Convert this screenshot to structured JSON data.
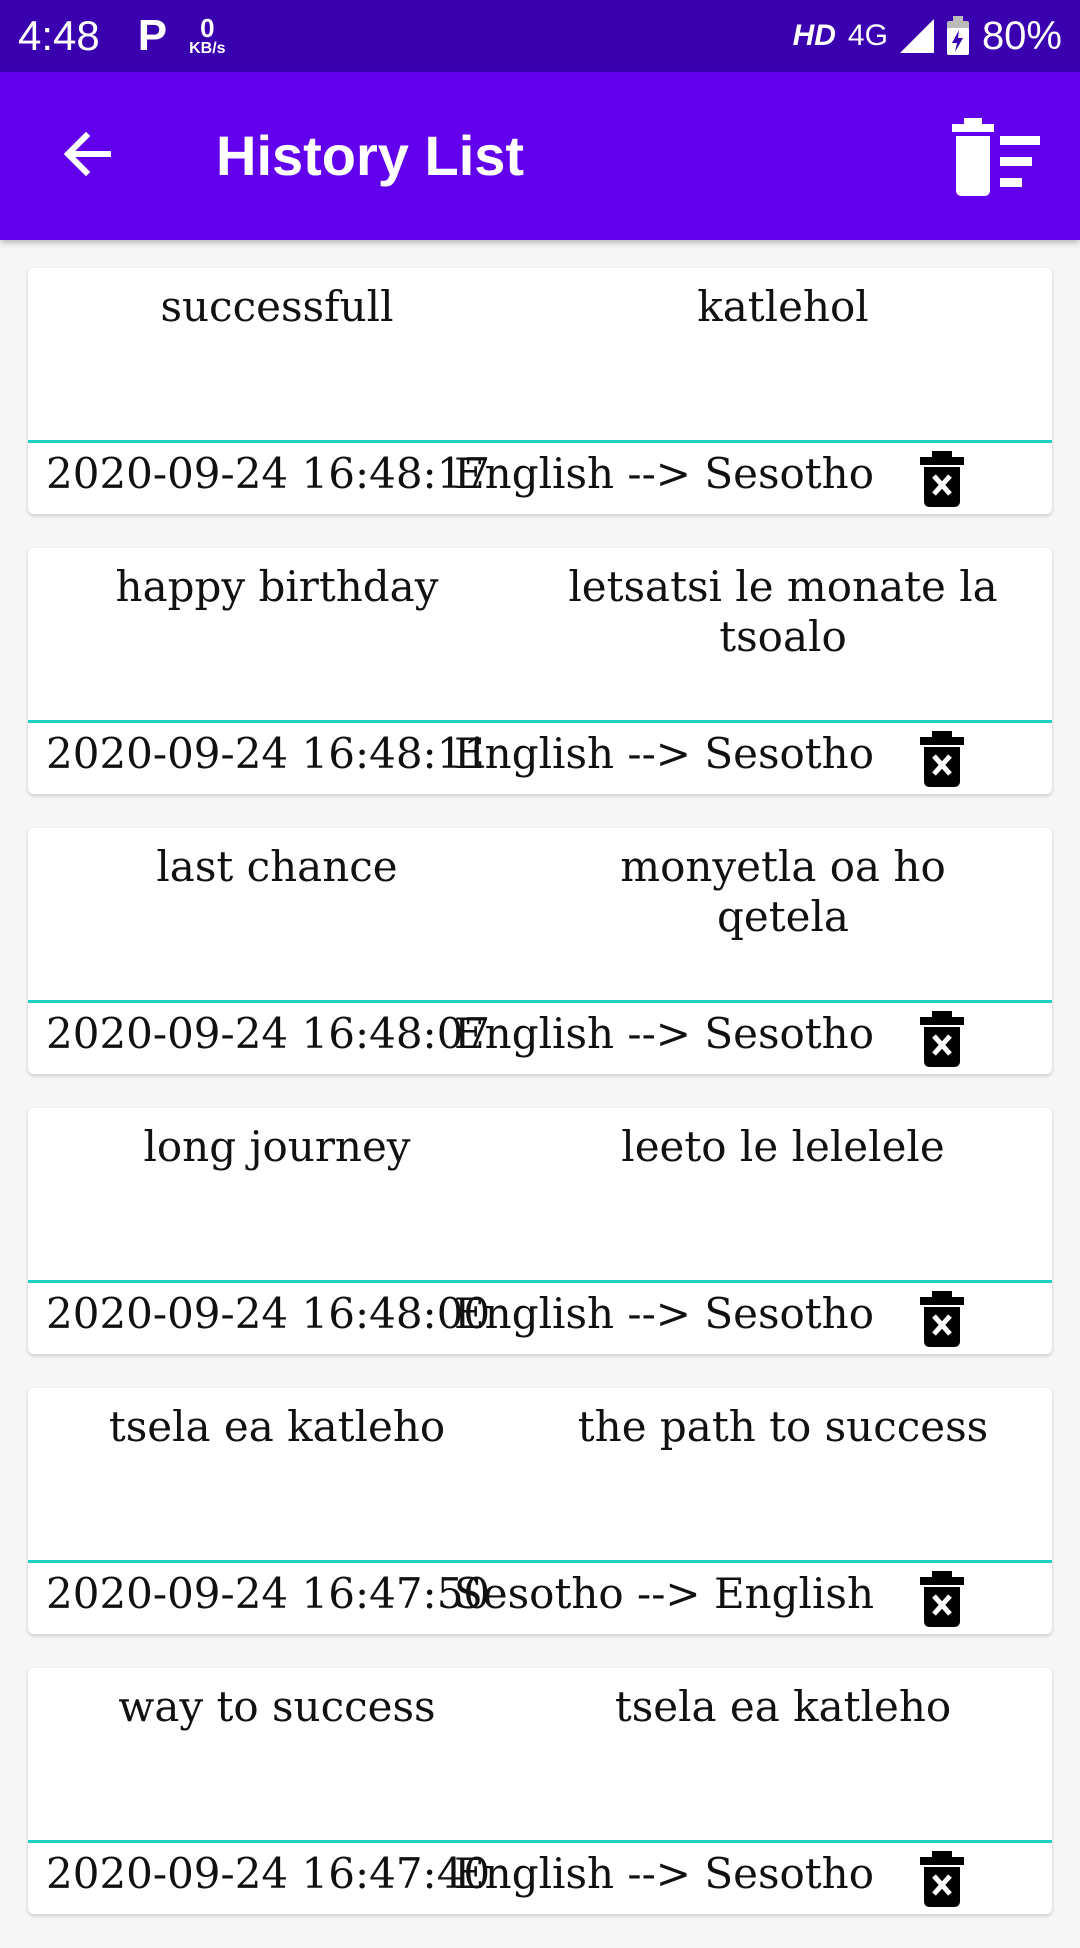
{
  "status_bar": {
    "time": "4:48",
    "p_badge": "P",
    "speed_value": "0",
    "speed_unit": "KB/s",
    "hd": "HD",
    "network": "4G",
    "battery": "80%"
  },
  "app_bar": {
    "title": "History List",
    "back_icon": "arrow-back-icon",
    "clear_icon": "delete-sweep-icon"
  },
  "history": [
    {
      "source": "successfull",
      "target": "katlehol",
      "timestamp": "2020-09-24 16:48:17",
      "direction": "English --> Sesotho"
    },
    {
      "source": "happy birthday",
      "target": "letsatsi le monate la tsoalo",
      "timestamp": "2020-09-24 16:48:11",
      "direction": "English --> Sesotho"
    },
    {
      "source": "last chance",
      "target": "monyetla oa ho qetela",
      "timestamp": "2020-09-24 16:48:07",
      "direction": "English --> Sesotho"
    },
    {
      "source": "long journey",
      "target": "leeto le lelelele",
      "timestamp": "2020-09-24 16:48:00",
      "direction": "English --> Sesotho"
    },
    {
      "source": "tsela ea katleho",
      "target": "the path to success",
      "timestamp": "2020-09-24 16:47:50",
      "direction": "Sesotho --> English"
    },
    {
      "source": "way to success",
      "target": "tsela ea katleho",
      "timestamp": "2020-09-24 16:47:40",
      "direction": "English --> Sesotho"
    }
  ],
  "colors": {
    "status_bar": "#3a00b0",
    "app_bar": "#6200ee",
    "divider": "#1fd1c0"
  }
}
